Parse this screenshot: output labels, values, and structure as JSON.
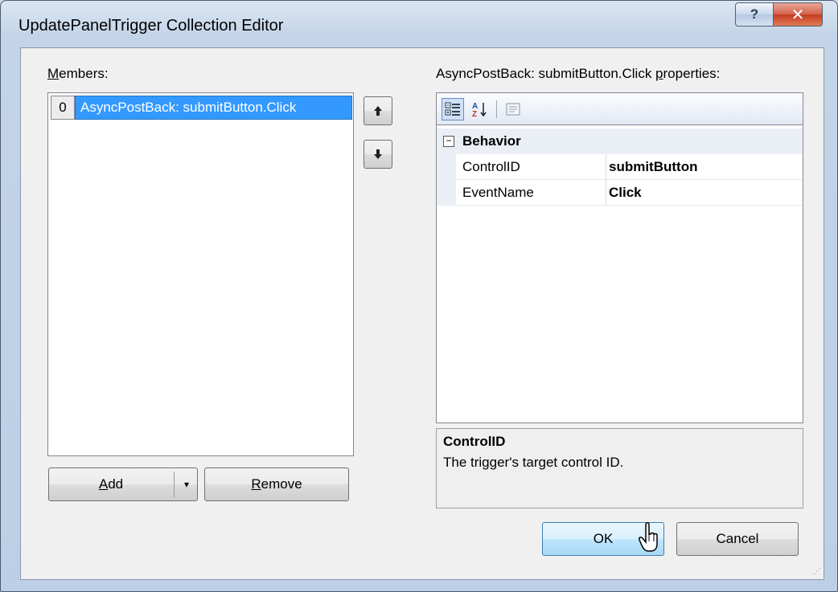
{
  "window": {
    "title": "UpdatePanelTrigger Collection Editor",
    "help_label": "?",
    "close_label": "✕"
  },
  "members": {
    "label_prefix": "",
    "label_mnemonic": "M",
    "label_rest": "embers:",
    "items": [
      {
        "index": "0",
        "text": "AsyncPostBack: submitButton.Click",
        "selected": true
      }
    ],
    "move_up_label": "🠕",
    "move_down_label": "🠗"
  },
  "buttons": {
    "add_mnemonic": "A",
    "add_rest": "dd",
    "add_dropdown": "▾",
    "remove_mnemonic": "R",
    "remove_rest": "emove",
    "ok_label": "OK",
    "cancel_label": "Cancel"
  },
  "properties": {
    "header_prefix": "AsyncPostBack: submitButton.Click ",
    "header_mnemonic": "p",
    "header_rest": "roperties:",
    "toolbar": {
      "categorized_icon": "categorized-icon",
      "alphabetical_icon": "alphabetical-icon",
      "property_pages_icon": "property-pages-icon"
    },
    "category": {
      "toggle": "⊟",
      "name": "Behavior"
    },
    "rows": [
      {
        "name": "ControlID",
        "value": "submitButton"
      },
      {
        "name": "EventName",
        "value": "Click"
      }
    ]
  },
  "description": {
    "title": "ControlID",
    "text": "The trigger's target control ID."
  },
  "colors": {
    "selection": "#3399ff",
    "ok_accent": "#3c7fb1"
  }
}
